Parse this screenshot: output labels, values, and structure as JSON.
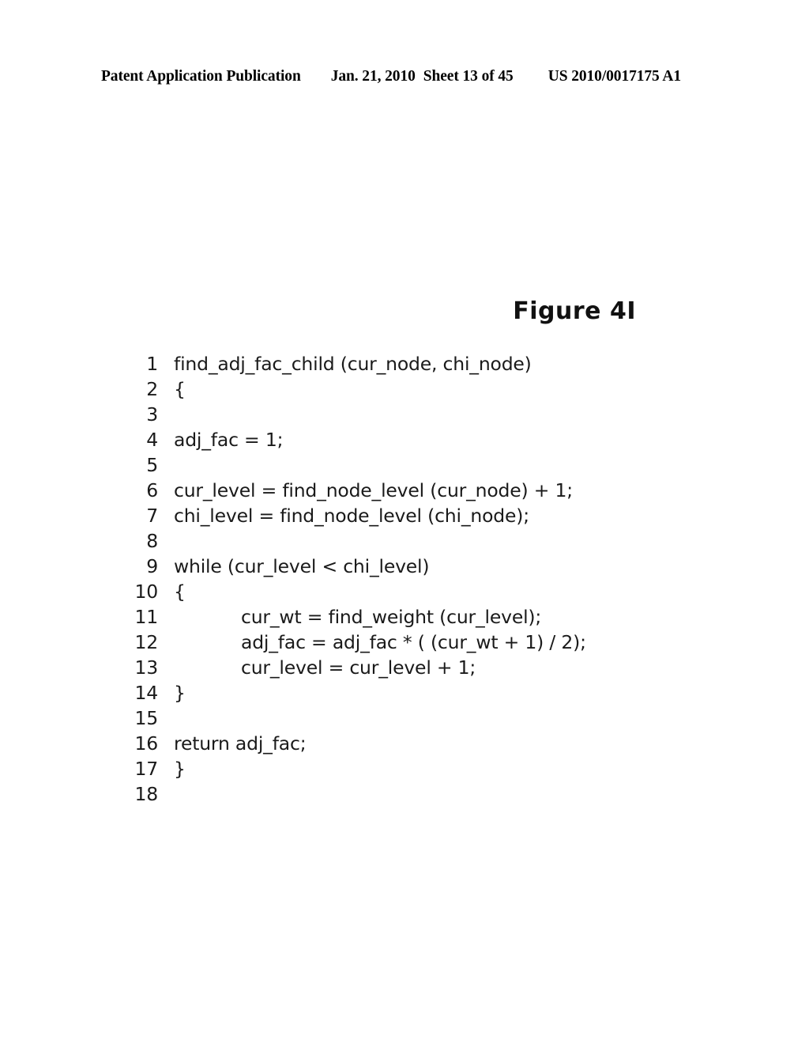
{
  "header": {
    "publication": "Patent Application Publication",
    "date": "Jan. 21, 2010",
    "sheet": "Sheet 13 of 45",
    "doc_number": "US 2010/0017175 A1"
  },
  "figure": {
    "title": "Figure 4I"
  },
  "code": {
    "lines": [
      {
        "number": "1",
        "text": "find_adj_fac_child (cur_node, chi_node)",
        "indent": 0
      },
      {
        "number": "2",
        "text": "{",
        "indent": 0
      },
      {
        "number": "3",
        "text": "",
        "indent": 0
      },
      {
        "number": "4",
        "text": "adj_fac = 1;",
        "indent": 0
      },
      {
        "number": "5",
        "text": "",
        "indent": 0
      },
      {
        "number": "6",
        "text": "cur_level = find_node_level (cur_node) + 1;",
        "indent": 0
      },
      {
        "number": "7",
        "text": "chi_level = find_node_level (chi_node);",
        "indent": 0
      },
      {
        "number": "8",
        "text": "",
        "indent": 0
      },
      {
        "number": "9",
        "text": "while (cur_level < chi_level)",
        "indent": 0
      },
      {
        "number": "10",
        "text": "{",
        "indent": 0
      },
      {
        "number": "11",
        "text": "cur_wt = find_weight (cur_level);",
        "indent": 1
      },
      {
        "number": "12",
        "text": "adj_fac = adj_fac * ( (cur_wt + 1) / 2);",
        "indent": 1
      },
      {
        "number": "13",
        "text": "cur_level = cur_level + 1;",
        "indent": 1
      },
      {
        "number": "14",
        "text": "}",
        "indent": 0
      },
      {
        "number": "15",
        "text": "",
        "indent": 0
      },
      {
        "number": "16",
        "text": "return adj_fac;",
        "indent": 0
      },
      {
        "number": "17",
        "text": "}",
        "indent": 0
      },
      {
        "number": "18",
        "text": "",
        "indent": 0
      }
    ]
  }
}
